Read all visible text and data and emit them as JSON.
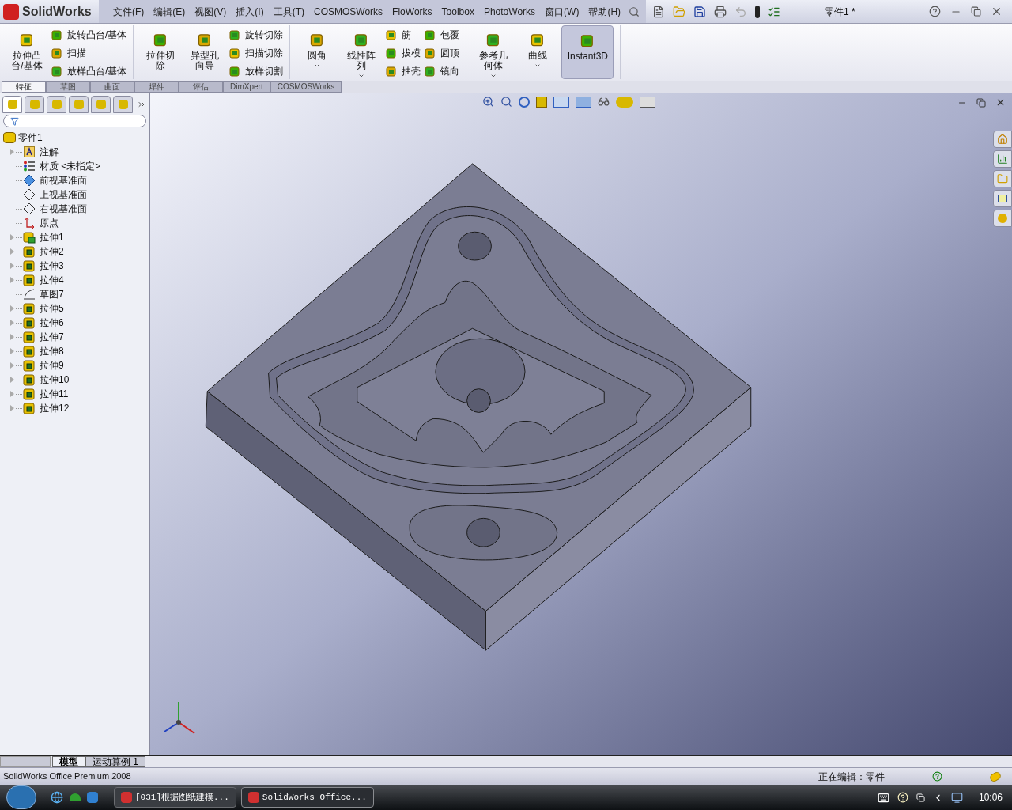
{
  "app": {
    "logo": "SolidWorks",
    "document_title": "零件1 *"
  },
  "menu": [
    "文件(F)",
    "编辑(E)",
    "视图(V)",
    "插入(I)",
    "工具(T)",
    "COSMOSWorks",
    "FloWorks",
    "Toolbox",
    "PhotoWorks",
    "窗口(W)",
    "帮助(H)"
  ],
  "ribbon": [
    {
      "items": [
        {
          "kind": "large",
          "label": "拉伸凸台/基体",
          "dropdown": false,
          "selected": false
        },
        {
          "kind": "stack",
          "buttons": [
            {
              "label": "旋转凸台/基体"
            },
            {
              "label": "扫描"
            },
            {
              "label": "放样凸台/基体"
            }
          ]
        }
      ]
    },
    {
      "items": [
        {
          "kind": "large",
          "label": "拉伸切除",
          "dropdown": false,
          "selected": false
        },
        {
          "kind": "large",
          "label": "异型孔向导",
          "dropdown": false,
          "selected": false
        },
        {
          "kind": "stack",
          "buttons": [
            {
              "label": "旋转切除"
            },
            {
              "label": "扫描切除"
            },
            {
              "label": "放样切割"
            }
          ]
        }
      ]
    },
    {
      "items": [
        {
          "kind": "large",
          "label": "圆角",
          "dropdown": true,
          "selected": false
        },
        {
          "kind": "large",
          "label": "线性阵列",
          "dropdown": true,
          "selected": false
        },
        {
          "kind": "stack",
          "buttons": [
            {
              "label": "筋"
            },
            {
              "label": "拔模"
            },
            {
              "label": "抽壳"
            }
          ]
        },
        {
          "kind": "stack",
          "buttons": [
            {
              "label": "包覆"
            },
            {
              "label": "圆顶"
            },
            {
              "label": "镜向"
            }
          ]
        }
      ]
    },
    {
      "items": [
        {
          "kind": "large",
          "label": "参考几何体",
          "dropdown": true,
          "selected": false
        },
        {
          "kind": "large",
          "label": "曲线",
          "dropdown": true,
          "selected": false
        },
        {
          "kind": "large",
          "label": "Instant3D",
          "dropdown": false,
          "selected": true
        }
      ]
    }
  ],
  "command_tabs": [
    {
      "label": "特征",
      "selected": true
    },
    {
      "label": "草图",
      "selected": false
    },
    {
      "label": "曲面",
      "selected": false
    },
    {
      "label": "焊件",
      "selected": false
    },
    {
      "label": "评估",
      "selected": false
    },
    {
      "label": "DimXpert",
      "selected": false
    },
    {
      "label": "COSMOSWorks",
      "selected": false
    }
  ],
  "panel_tabs": [
    {
      "selected": true
    },
    {
      "selected": false
    },
    {
      "selected": false
    },
    {
      "selected": false
    },
    {
      "selected": false
    },
    {
      "selected": false
    }
  ],
  "feature_tree": {
    "label": "零件1",
    "children": [
      {
        "label": "注解",
        "kind": "annotations",
        "expandable": true
      },
      {
        "label": "材质 <未指定>",
        "kind": "material",
        "expandable": false
      },
      {
        "label": "前视基准面",
        "kind": "plane-front",
        "expandable": false
      },
      {
        "label": "上视基准面",
        "kind": "plane",
        "expandable": false
      },
      {
        "label": "右视基准面",
        "kind": "plane",
        "expandable": false
      },
      {
        "label": "原点",
        "kind": "origin",
        "expandable": false
      },
      {
        "label": "拉伸1",
        "kind": "extrude-base",
        "expandable": true
      },
      {
        "label": "拉伸2",
        "kind": "extrude",
        "expandable": true
      },
      {
        "label": "拉伸3",
        "kind": "extrude",
        "expandable": true
      },
      {
        "label": "拉伸4",
        "kind": "extrude",
        "expandable": true
      },
      {
        "label": "草图7",
        "kind": "sketch",
        "expandable": false
      },
      {
        "label": "拉伸5",
        "kind": "extrude",
        "expandable": true
      },
      {
        "label": "拉伸6",
        "kind": "extrude",
        "expandable": true
      },
      {
        "label": "拉伸7",
        "kind": "extrude",
        "expandable": true
      },
      {
        "label": "拉伸8",
        "kind": "extrude",
        "expandable": true
      },
      {
        "label": "拉伸9",
        "kind": "extrude",
        "expandable": true
      },
      {
        "label": "拉伸10",
        "kind": "extrude",
        "expandable": true
      },
      {
        "label": "拉伸11",
        "kind": "extrude",
        "expandable": true
      },
      {
        "label": "拉伸12",
        "kind": "extrude",
        "expandable": true
      }
    ]
  },
  "bottom_tabs": [
    {
      "label": "模型",
      "selected": true
    },
    {
      "label": "运动算例 1",
      "selected": false
    }
  ],
  "status_bar": {
    "product": "SolidWorks Office Premium 2008",
    "mode": "正在编辑：零件"
  },
  "taskbar": {
    "tasks": [
      {
        "label": "[031]根据图纸建模...",
        "selected": false
      },
      {
        "label": "SolidWorks Office...",
        "selected": true
      }
    ],
    "clock": "10:06"
  }
}
